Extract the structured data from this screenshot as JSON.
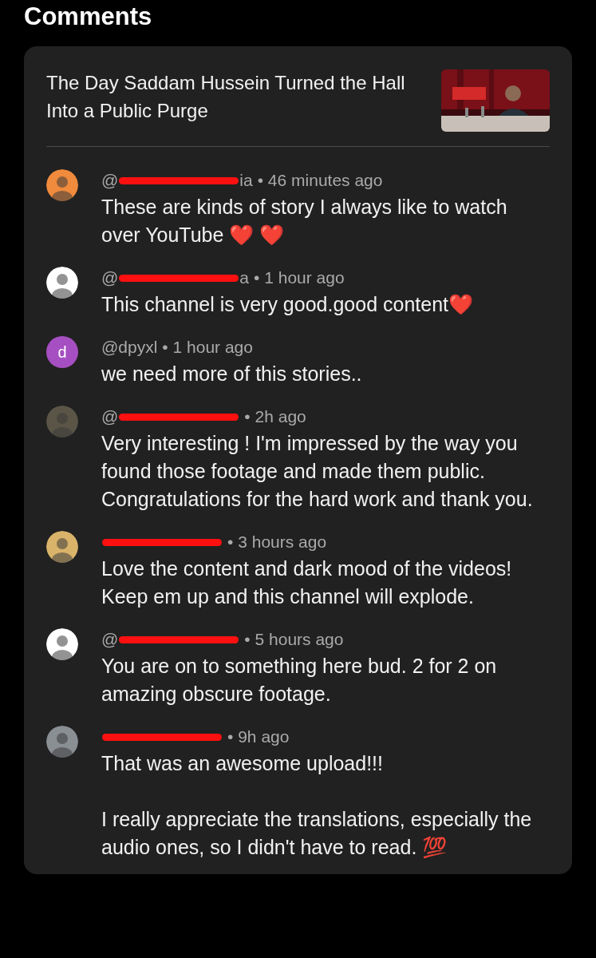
{
  "heading": "Comments",
  "video": {
    "title": "The Day Saddam Hussein Turned the Hall Into a Public Purge"
  },
  "comments": [
    {
      "handle_start": "@",
      "redacted": true,
      "handle_end": "ia",
      "time": "• 46 minutes ago",
      "text": "These are kinds of story I always like to watch over YouTube ❤️ ❤️"
    },
    {
      "handle_start": "@",
      "redacted": true,
      "handle_end": "a",
      "time": "• 1 hour ago",
      "text": "This channel is very good.good content❤️"
    },
    {
      "avatar": {
        "kind": "letter",
        "letter": "d",
        "color": "#a64fc2"
      },
      "handle_start": "@dpyxl",
      "redacted": false,
      "time": "• 1 hour ago",
      "text": "we need more of this stories.."
    },
    {
      "handle_start": "@",
      "redacted": true,
      "time": "• 2h ago",
      "text": "Very interesting ! I'm impressed by the way you found those footage and made them public. Congratulations for the hard work and thank you."
    },
    {
      "redacted": true,
      "time": "• 3 hours ago",
      "text": "Love the content and dark mood of the videos! Keep em up and this channel will explode."
    },
    {
      "handle_start": "@",
      "redacted": true,
      "time": "• 5 hours ago",
      "text": "You are on to something here bud. 2 for 2 on amazing obscure footage."
    },
    {
      "redacted": true,
      "time": "• 9h ago",
      "text": "That was an awesome upload!!!\n\nI really appreciate the translations, especially the audio ones, so I didn't have to read. 💯"
    }
  ]
}
